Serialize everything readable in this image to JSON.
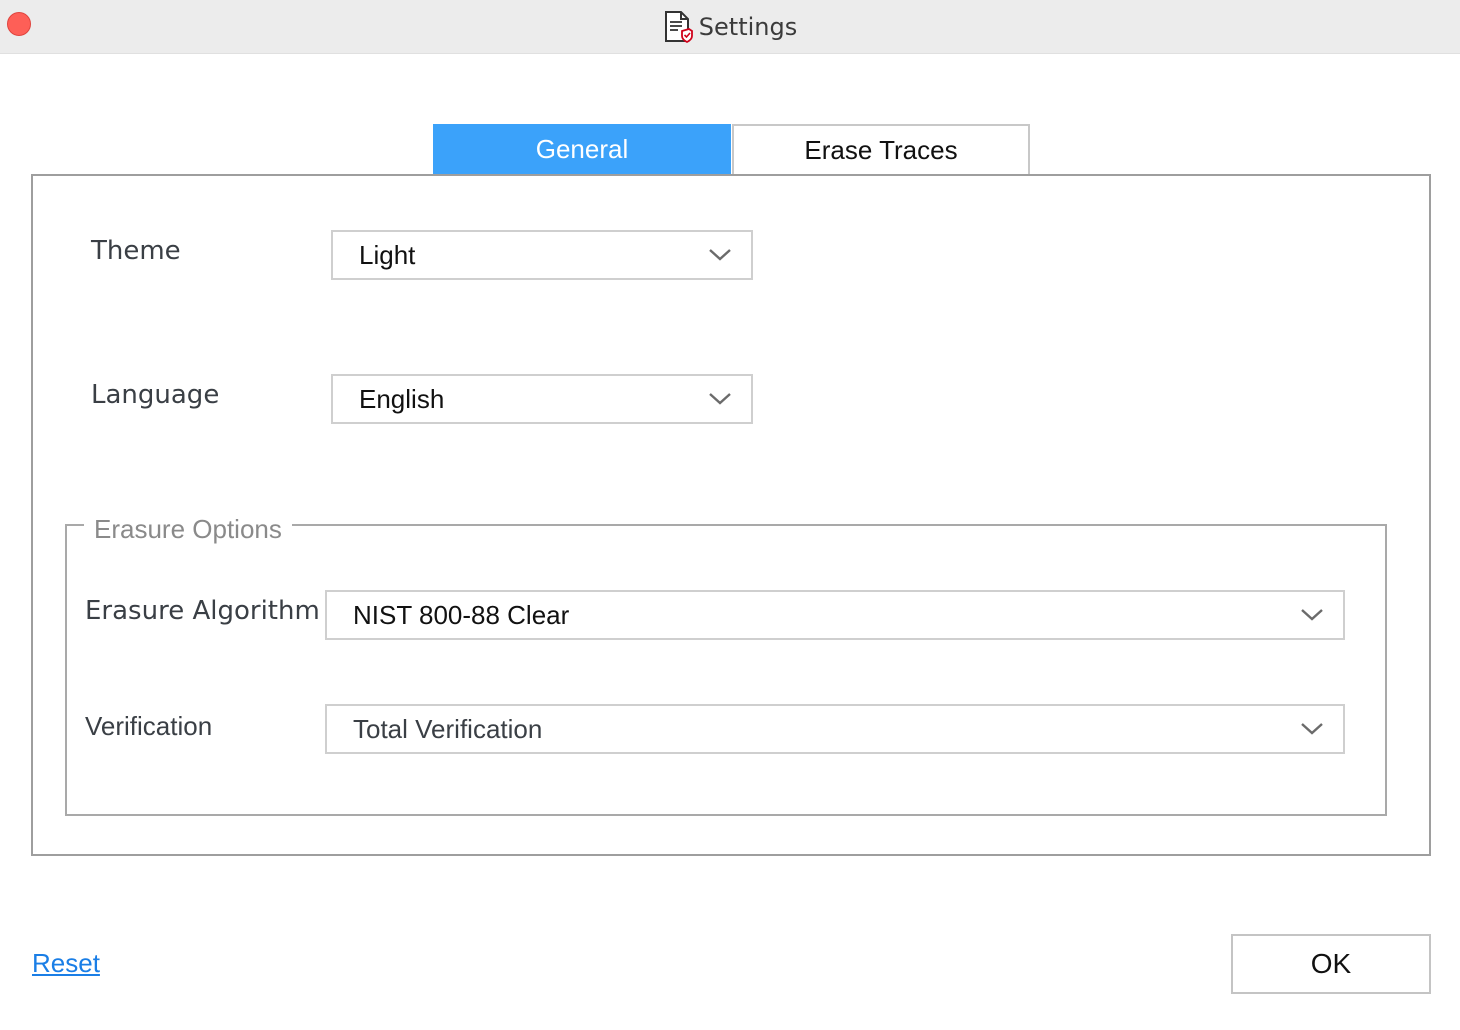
{
  "window": {
    "title": "Settings",
    "title_icon": "document-shield-icon",
    "close_color": "#fe5f57"
  },
  "tabs": [
    {
      "label": "General",
      "selected": true
    },
    {
      "label": "Erase Traces",
      "selected": false
    }
  ],
  "general": {
    "theme": {
      "label": "Theme",
      "value": "Light"
    },
    "language": {
      "label": "Language",
      "value": "English"
    },
    "erasure_options": {
      "legend": "Erasure Options",
      "algorithm": {
        "label": "Erasure Algorithm",
        "value": "NIST 800-88 Clear"
      },
      "verification": {
        "label": "Verification",
        "value": "Total Verification"
      }
    }
  },
  "footer": {
    "reset_label": "Reset",
    "ok_label": "OK"
  },
  "colors": {
    "accent": "#3ba2fa",
    "link": "#1a7ee6"
  }
}
